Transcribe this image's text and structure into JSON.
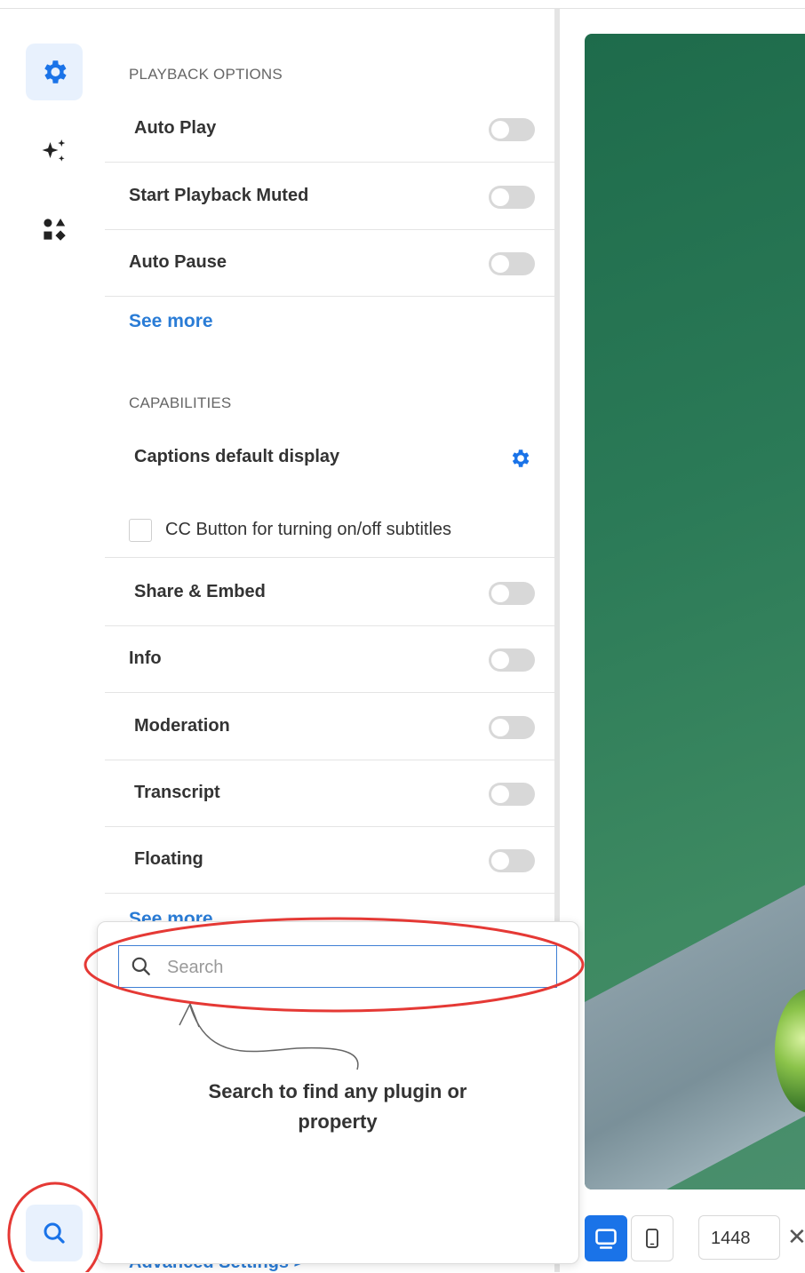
{
  "panel": {
    "playback_title": "PLAYBACK OPTIONS",
    "playback_items": [
      "Auto Play",
      "Start Playback Muted",
      "Auto Pause"
    ],
    "see_more": "See more",
    "capabilities_title": "CAPABILITIES",
    "captions_label": "Captions default display",
    "cc_label": "CC Button for turning on/off subtitles",
    "capability_items": [
      "Share & Embed",
      "Info",
      "Moderation",
      "Transcript",
      "Floating"
    ],
    "see_more_2": "See more",
    "advanced": "Advanced Settings >"
  },
  "search": {
    "placeholder": "Search",
    "value": "",
    "hint": "Search to find any plugin or property"
  },
  "toolbar": {
    "width_value": "1448",
    "close_glyph": "✕"
  },
  "icons": {
    "rail": [
      "gear-icon",
      "sparkles-icon",
      "shapes-icon",
      "search-icon"
    ],
    "devices": [
      "desktop-icon",
      "mobile-icon"
    ]
  },
  "colors": {
    "accent": "#1a73e8",
    "link": "#2a7cd6",
    "highlight_ring": "#e53935",
    "preview_bg": "#2b7a57"
  }
}
